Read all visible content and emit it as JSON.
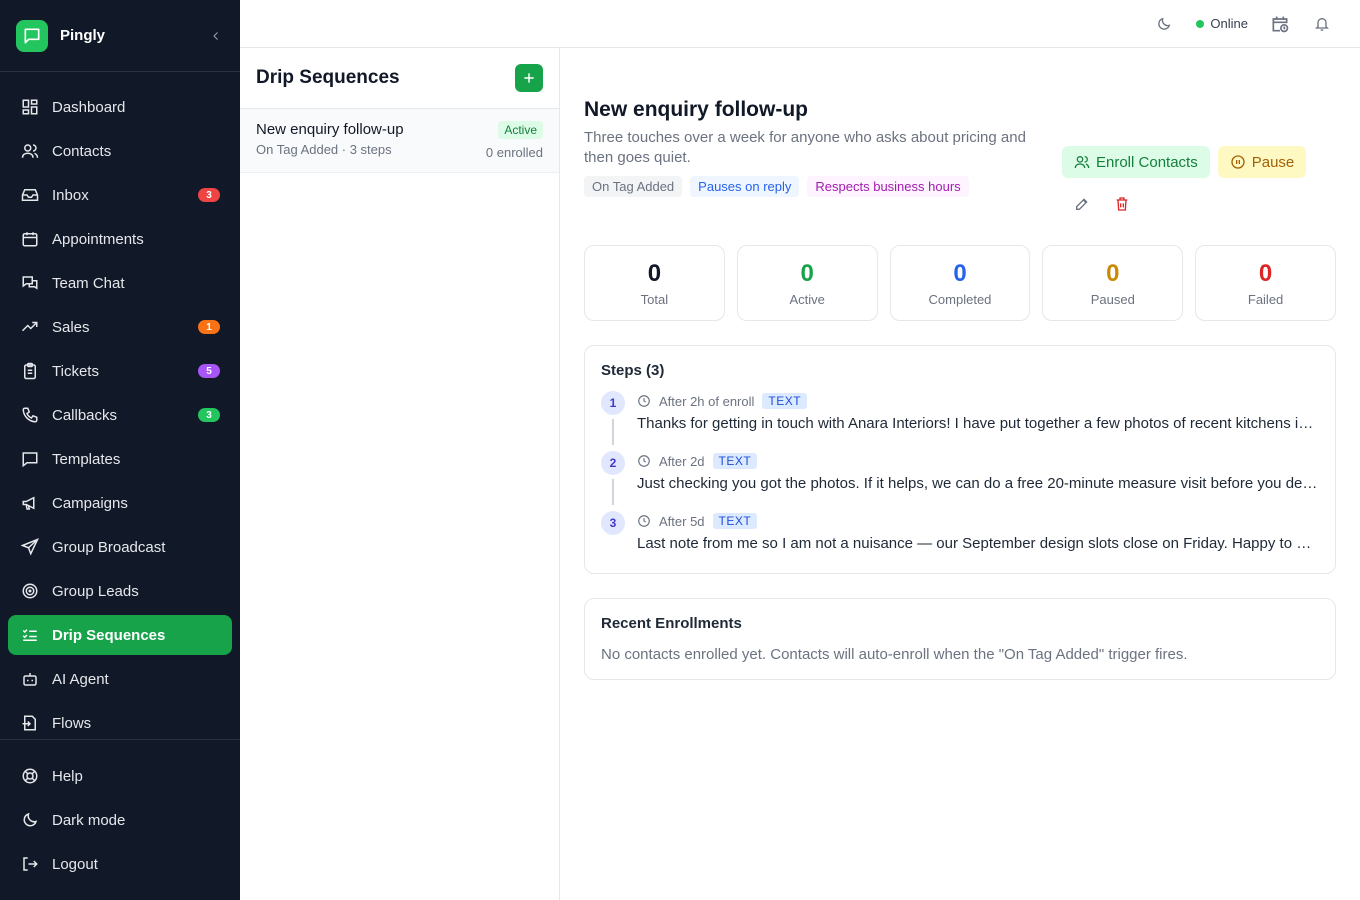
{
  "app": {
    "name": "Pingly"
  },
  "colors": {
    "brand": "#22c55e",
    "active_nav": "#16a34a",
    "sidebar_bg": "#111827"
  },
  "sidebar": {
    "items": [
      {
        "label": "Dashboard",
        "icon": "dashboard-icon"
      },
      {
        "label": "Contacts",
        "icon": "users-icon"
      },
      {
        "label": "Inbox",
        "icon": "inbox-icon",
        "badge": "3",
        "badge_color": "#ef4444"
      },
      {
        "label": "Appointments",
        "icon": "calendar-icon"
      },
      {
        "label": "Team Chat",
        "icon": "chat-icon"
      },
      {
        "label": "Sales",
        "icon": "trending-up-icon",
        "badge": "1",
        "badge_color": "#f97316"
      },
      {
        "label": "Tickets",
        "icon": "clipboard-icon",
        "badge": "5",
        "badge_color": "#a855f7"
      },
      {
        "label": "Callbacks",
        "icon": "phone-icon",
        "badge": "3",
        "badge_color": "#22c55e"
      },
      {
        "label": "Templates",
        "icon": "message-square-icon"
      },
      {
        "label": "Campaigns",
        "icon": "megaphone-icon"
      },
      {
        "label": "Group Broadcast",
        "icon": "send-icon"
      },
      {
        "label": "Group Leads",
        "icon": "target-icon"
      },
      {
        "label": "Drip Sequences",
        "icon": "list-checks-icon",
        "active": true
      },
      {
        "label": "AI Agent",
        "icon": "bot-icon"
      },
      {
        "label": "Flows",
        "icon": "flow-icon"
      }
    ],
    "bottom": [
      {
        "label": "Help",
        "icon": "lifebuoy-icon"
      },
      {
        "label": "Dark mode",
        "icon": "moon-icon"
      },
      {
        "label": "Logout",
        "icon": "logout-icon"
      }
    ]
  },
  "topbar": {
    "status": "Online"
  },
  "list": {
    "title": "Drip Sequences",
    "items": [
      {
        "name": "New enquiry follow-up",
        "sub": "On Tag Added · 3 steps",
        "status": "Active",
        "enrolled": "0 enrolled"
      }
    ]
  },
  "detail": {
    "title": "New enquiry follow-up",
    "description": "Three touches over a week for anyone who asks about pricing and then goes quiet.",
    "tags": [
      "On Tag Added",
      "Pauses on reply",
      "Respects business hours"
    ],
    "enroll_label": "Enroll Contacts",
    "pause_label": "Pause",
    "stats": [
      {
        "value": "0",
        "label": "Total",
        "color": "#111827"
      },
      {
        "value": "0",
        "label": "Active",
        "color": "#16a34a"
      },
      {
        "value": "0",
        "label": "Completed",
        "color": "#2563eb"
      },
      {
        "value": "0",
        "label": "Paused",
        "color": "#ca8a04"
      },
      {
        "value": "0",
        "label": "Failed",
        "color": "#dc2626"
      }
    ],
    "steps_title": "Steps (3)",
    "steps": [
      {
        "num": "1",
        "delay": "After 2h of enroll",
        "type": "TEXT",
        "text": "Thanks for getting in touch with Anara Interiors! I have put together a few photos of recent kitchens in your area so you can get a feel for what we do."
      },
      {
        "num": "2",
        "delay": "After 2d",
        "type": "TEXT",
        "text": "Just checking you got the photos. If it helps, we can do a free 20-minute measure visit before you decide on anything."
      },
      {
        "num": "3",
        "delay": "After 5d",
        "type": "TEXT",
        "text": "Last note from me so I am not a nuisance — our September design slots close on Friday. Happy to hold one for you if you reply."
      }
    ],
    "enrollments_title": "Recent Enrollments",
    "enrollments_empty": "No contacts enrolled yet. Contacts will auto-enroll when the \"On Tag Added\" trigger fires."
  }
}
